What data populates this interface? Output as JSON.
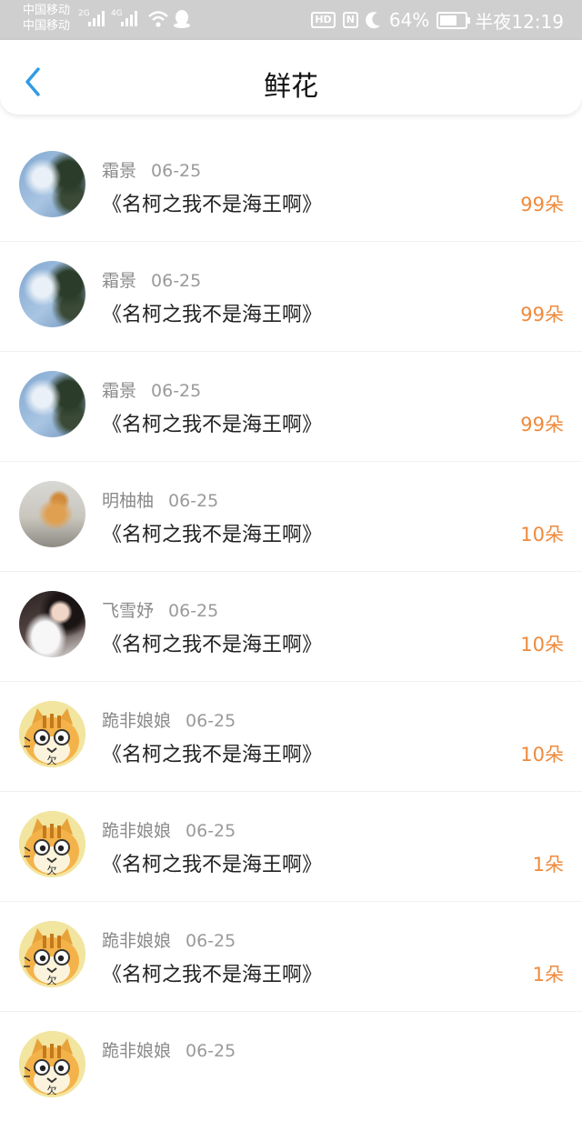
{
  "status_bar": {
    "carrier_1": "中国移动",
    "carrier_2": "中国移动",
    "net_1": "2G",
    "net_2": "4G",
    "battery_percent": "64%",
    "time": "半夜12:19"
  },
  "nav": {
    "title": "鲜花"
  },
  "records": [
    {
      "user": "霜景",
      "date": "06-25",
      "book": "《名柯之我不是海王啊》",
      "flowers": "99朵",
      "avatar": "sky"
    },
    {
      "user": "霜景",
      "date": "06-25",
      "book": "《名柯之我不是海王啊》",
      "flowers": "99朵",
      "avatar": "sky"
    },
    {
      "user": "霜景",
      "date": "06-25",
      "book": "《名柯之我不是海王啊》",
      "flowers": "99朵",
      "avatar": "sky"
    },
    {
      "user": "明柚柚",
      "date": "06-25",
      "book": "《名柯之我不是海王啊》",
      "flowers": "10朵",
      "avatar": "cat"
    },
    {
      "user": "飞雪妤",
      "date": "06-25",
      "book": "《名柯之我不是海王啊》",
      "flowers": "10朵",
      "avatar": "girl"
    },
    {
      "user": "跪非娘娘",
      "date": "06-25",
      "book": "《名柯之我不是海王啊》",
      "flowers": "10朵",
      "avatar": "cartoon"
    },
    {
      "user": "跪非娘娘",
      "date": "06-25",
      "book": "《名柯之我不是海王啊》",
      "flowers": "1朵",
      "avatar": "cartoon"
    },
    {
      "user": "跪非娘娘",
      "date": "06-25",
      "book": "《名柯之我不是海王啊》",
      "flowers": "1朵",
      "avatar": "cartoon"
    },
    {
      "user": "跪非娘娘",
      "date": "06-25",
      "book": "",
      "flowers": "",
      "avatar": "cartoon"
    }
  ],
  "colors": {
    "accent": "#ef8a3c",
    "back_arrow": "#2f9be6"
  }
}
